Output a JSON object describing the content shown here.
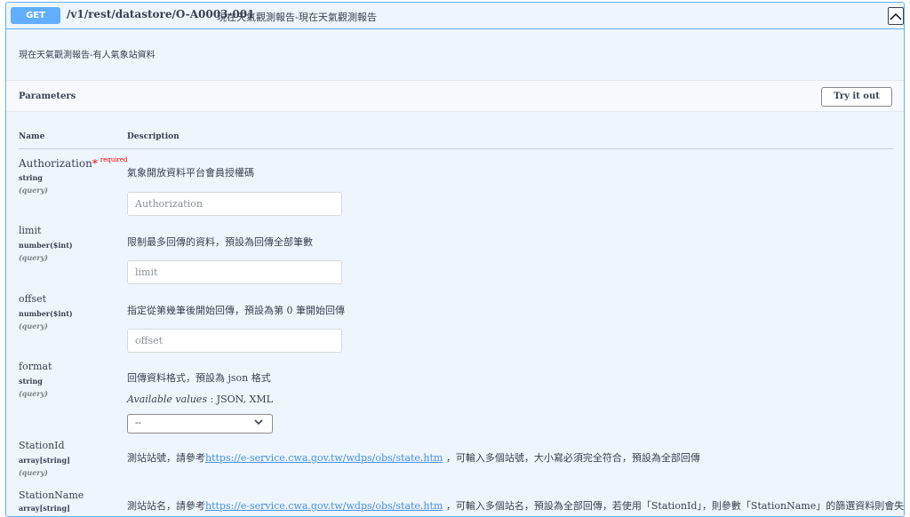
{
  "operation": {
    "method": "GET",
    "path": "/v1/rest/datastore/O-A0003-001",
    "summary": "現在天氣觀測報告-現在天氣觀測報告",
    "description": "現在天氣觀測報告-有人氣象站資料",
    "method_color": "#61affe"
  },
  "parameters_section": {
    "title": "Parameters",
    "try_button": "Try it out",
    "col_name": "Name",
    "col_description": "Description"
  },
  "params": [
    {
      "name": "Authorization",
      "required_star": "*",
      "required_text": "required",
      "type": "string",
      "in": "(query)",
      "description": "氣象開放資料平台會員授權碼",
      "placeholder": "Authorization"
    },
    {
      "name": "limit",
      "type": "number($int)",
      "in": "(query)",
      "description": "限制最多回傳的資料，預設為回傳全部筆數",
      "placeholder": "limit"
    },
    {
      "name": "offset",
      "type": "number($int)",
      "in": "(query)",
      "description": "指定從第幾筆後開始回傳，預設為第 0 筆開始回傳",
      "placeholder": "offset"
    },
    {
      "name": "format",
      "type": "string",
      "in": "(query)",
      "description": "回傳資料格式，預設為 json 格式",
      "available_label": "Available values",
      "available_values": " : JSON, XML",
      "select_value": "--"
    },
    {
      "name": "StationId",
      "type": "array[string]",
      "in": "(query)",
      "desc_pre": "測站站號，請參考",
      "link": "https://e-service.cwa.gov.tw/wdps/obs/state.htm",
      "desc_post": " ，可輸入多個站號，大小寫必須完全符合，預設為全部回傳"
    },
    {
      "name": "StationName",
      "type": "array[string]",
      "desc_pre": "測站站名，請參考",
      "link": "https://e-service.cwa.gov.tw/wdps/obs/state.htm",
      "desc_post": " ，可輸入多個站名，預設為全部回傳，若使用「StationId」，則參數「StationName」的篩選資料則會失效，只會"
    }
  ]
}
